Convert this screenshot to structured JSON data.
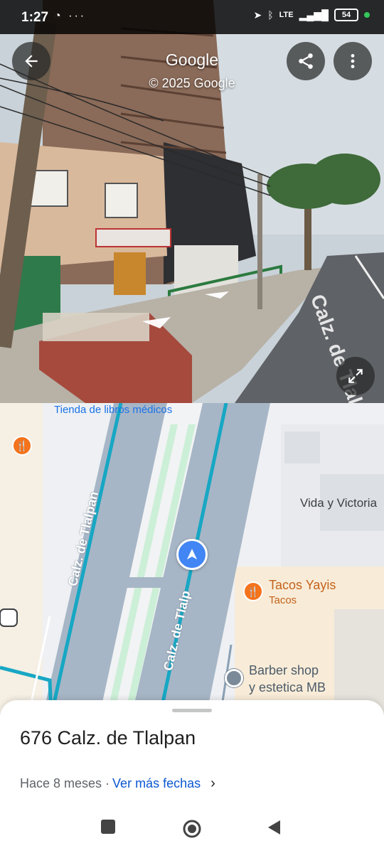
{
  "status_bar": {
    "time": "1:27",
    "left_icons": "whatsapp-icon, more-dots",
    "network": "LTE",
    "battery": "54"
  },
  "street_view": {
    "title": "Google",
    "copyright": "© 2025 Google",
    "road_marking": "Calz. de Tlalpan"
  },
  "map": {
    "labels": {
      "bookstore": "Tienda de libros médicos",
      "vida": "Vida y Victoria",
      "tacos_name": "Tacos Yayis",
      "tacos_type": "Tacos",
      "barber_line1": "Barber shop",
      "barber_line2": "y estetica MB",
      "street_left": "Calz. de Tlalpan",
      "street_right": "Calz. de Tlalp"
    },
    "colors": {
      "road": "#a7b6c6",
      "route": "#17a7c4",
      "poi_food": "#f4731c",
      "location": "#4285f4"
    }
  },
  "sheet": {
    "address": "676 Calz. de Tlalpan",
    "date_text": "Hace 8 meses ·",
    "date_link": "Ver más fechas"
  }
}
